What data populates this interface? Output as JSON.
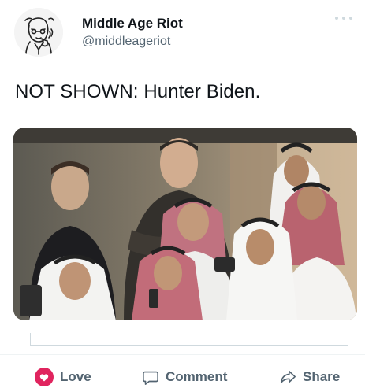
{
  "author": {
    "name": "Middle Age Riot",
    "handle": "@middleageriot",
    "avatar_icon": "cartoon-man-with-pipe-avatar"
  },
  "tweet": {
    "text": "NOT SHOWN: Hunter Biden."
  },
  "media": {
    "kind": "photo",
    "icon": "photo-of-men-in-stadium-box"
  },
  "actions": {
    "love_label": "Love",
    "comment_label": "Comment",
    "share_label": "Share"
  },
  "colors": {
    "love": "#e0245e",
    "secondary_text": "#536471",
    "primary_text": "#0f1419"
  }
}
